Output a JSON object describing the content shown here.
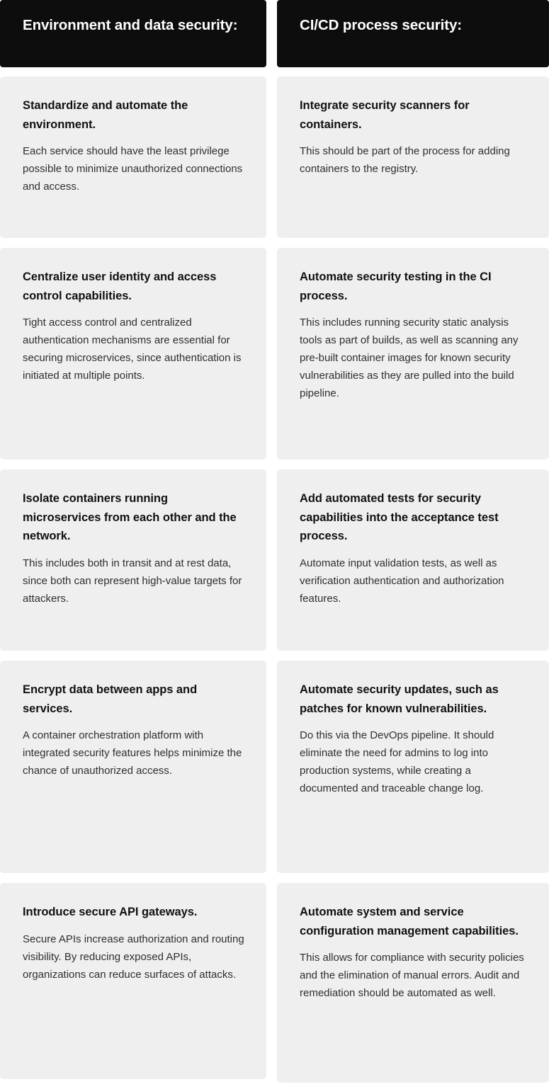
{
  "columns": [
    {
      "header": "Environment and data security:",
      "cards": [
        {
          "title": "Standardize and automate the environment.",
          "body": "Each service should have the least privilege possible to minimize unauthorized connections and access."
        },
        {
          "title": "Centralize user identity and access control capabilities.",
          "body": "Tight access control and centralized authentication mechanisms are essential for securing microservices, since authentication is initiated at multiple points."
        },
        {
          "title": "Isolate containers running microservices from each other and the network.",
          "body": "This includes both in transit and at rest data, since both can represent high-value targets for attackers."
        },
        {
          "title": "Encrypt data between apps and services.",
          "body": "A container orchestration platform with integrated security features helps minimize the chance of unauthorized access."
        },
        {
          "title": "Introduce secure API gateways.",
          "body": "Secure APIs increase authorization and routing visibility. By reducing exposed APIs, organizations can reduce surfaces of attacks."
        }
      ]
    },
    {
      "header": "CI/CD process security:",
      "cards": [
        {
          "title": "Integrate security scanners for containers.",
          "body": "This should be part of the process for adding containers to the registry."
        },
        {
          "title": "Automate security testing in the CI process.",
          "body": "This includes running security static analysis tools as part of builds, as well as scanning any pre-built container images for known security vulnerabilities as they are pulled into the build pipeline."
        },
        {
          "title": "Add automated tests for security capabilities into the acceptance test process.",
          "body": "Automate input validation tests, as well as verification authentication and authorization features."
        },
        {
          "title": "Automate security updates, such as patches for known vulnerabilities.",
          "body": "Do this via the DevOps pipeline. It should eliminate the need for admins to log into production systems, while creating a documented and traceable change log."
        },
        {
          "title": "Automate system and service configuration management capabilities.",
          "body": "This allows for compliance with security policies and the elimination of manual errors. Audit and remediation should be automated as well."
        }
      ]
    }
  ],
  "colors": {
    "header_background": "#0d0d0d",
    "header_text": "#ffffff",
    "card_background": "#efefef",
    "card_title_text": "#111111",
    "card_body_text": "#2f2f2f",
    "page_background": "#ffffff"
  }
}
